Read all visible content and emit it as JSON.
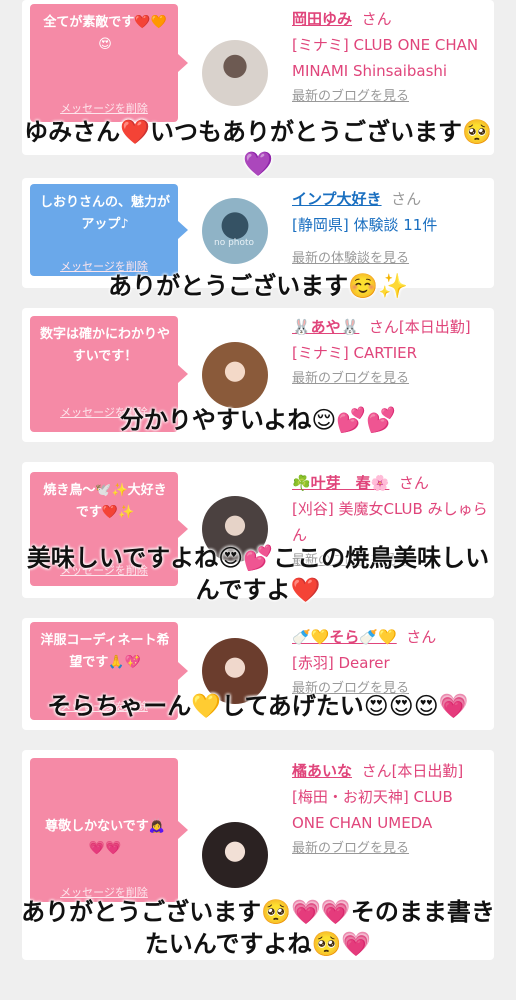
{
  "cards": [
    {
      "bubble_text": "全てが素敵です❤️🧡😍",
      "delete_label": "メッセージを削除",
      "name": "岡田ゆみ",
      "san": "さん",
      "detail": "[ミナミ] CLUB ONE CHAN MINAMI Shinsaibashi",
      "link": "最新のブログを見る",
      "avatar_icon": "woman-portrait-icon"
    },
    {
      "bubble_text": "しおりさんの、魅力がアップ♪",
      "delete_label": "メッセージを削除",
      "name": "インプ大好き",
      "san": "さん",
      "detail": "[静岡県] 体験談 11件",
      "link": "最新の体験談を見る",
      "avatar_icon": "no-photo-icon",
      "avatar_text": "no photo"
    },
    {
      "bubble_text": "数字は確かにわかりやすいです！",
      "delete_label": "メッセージを削除",
      "name": "🐰あや🐰",
      "san": "さん[本日出勤]",
      "detail": "[ミナミ] CARTIER",
      "link": "最新のブログを見る",
      "avatar_icon": "woman-portrait-icon"
    },
    {
      "bubble_text": "焼き鳥〜🕊️✨大好きです❤️✨",
      "delete_label": "メッセージを削除",
      "name": "☘️叶芽　春🌸",
      "san": "さん",
      "detail": "[刈谷] 美魔女CLUB みしゅらん",
      "link": "最新のブログを見る",
      "avatar_icon": "woman-portrait-icon"
    },
    {
      "bubble_text": "洋服コーディネート希望です🙏💖",
      "delete_label": "メッセージを削除",
      "name": "🍼💛そら🍼💛",
      "san": "さん",
      "detail": "[赤羽] Dearer",
      "link": "最新のブログを見る",
      "avatar_icon": "woman-portrait-icon"
    },
    {
      "bubble_text": "尊敬しかないです🙇‍♀️💗💗",
      "delete_label": "メッセージを削除",
      "name": "橘あいな",
      "san": "さん[本日出勤]",
      "detail": "[梅田・お初天神] CLUB ONE CHAN UMEDA",
      "link": "最新のブログを見る",
      "avatar_icon": "woman-portrait-icon"
    }
  ],
  "captions": [
    "ゆみさん❤️いつもありがとうございます🥺💜",
    "ありがとうございます☺️✨",
    "分かりやすいよね😌💕💕",
    "美味しいですよね😍💕ここの焼鳥美味しいんですよ❤️",
    "そらちゃーん💛してあげたい😍😍😍💗",
    "ありがとうございます🥺💗💗そのまま書きたいんですよね🥺💗"
  ],
  "colors": {
    "bubble_pink": "#f58aa6",
    "bubble_blue": "#6aa8ea",
    "name_pink": "#e0457b",
    "name_blue": "#1a6fc0"
  }
}
